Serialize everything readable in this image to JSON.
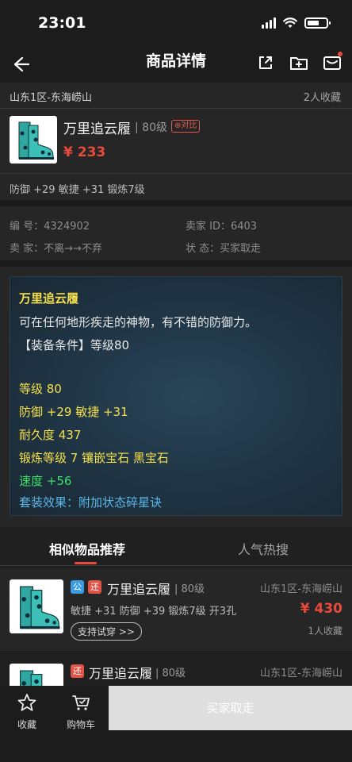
{
  "status": {
    "time": "23:01"
  },
  "nav": {
    "title": "商品详情"
  },
  "product": {
    "region": "山东1区-东海崂山",
    "fav_count": "2人收藏",
    "name": "万里追云履",
    "level": "80级",
    "compare": "对比",
    "price": "¥ 233",
    "stats": "防御 +29 敏捷 +31 锻炼7级"
  },
  "info": {
    "id_label": "编 号：4324902",
    "seller_id": "卖家 ID：6403",
    "seller": "卖 家：不离→→不弃",
    "state": "状 态：买家取走"
  },
  "description": {
    "title": "万里追云履",
    "intro": "可在任何地形疾走的神物，有不错的防御力。",
    "req": "【装备条件】等级80",
    "level": "等级 80",
    "attr": "防御 +29 敏捷 +31",
    "durability": "耐久度 437",
    "refine": "锻炼等级 7 镶嵌宝石 黑宝石",
    "speed": "速度 +56",
    "set": "套装效果：附加状态碎星诀"
  },
  "tabs": {
    "similar": "相似物品推荐",
    "hot": "人气热搜"
  },
  "list": [
    {
      "tag1": "公",
      "tag2": "还",
      "name": "万里追云履",
      "level": "80级",
      "region": "山东1区-东海崂山",
      "stats": "敏捷 +31 防御 +39 锻炼7级 开3孔",
      "trial": "支持试穿 >>",
      "price": "¥ 430",
      "fav": "1人收藏"
    },
    {
      "tag2": "还",
      "name": "万里追云履",
      "level": "80级",
      "region": "山东1区-东海崂山"
    }
  ],
  "bottom": {
    "fav": "收藏",
    "cart": "购物车",
    "buy": "买家取走"
  },
  "colors": {
    "accent": "#e84a3c",
    "bg": "#202020",
    "desc_yellow": "#f5e04b",
    "desc_green": "#3ee06a",
    "desc_blue": "#5bb8e8"
  },
  "icons": [
    "back-arrow-icon",
    "share-icon",
    "folder-icon",
    "mail-icon",
    "star-icon",
    "cart-icon",
    "boots-icon"
  ]
}
